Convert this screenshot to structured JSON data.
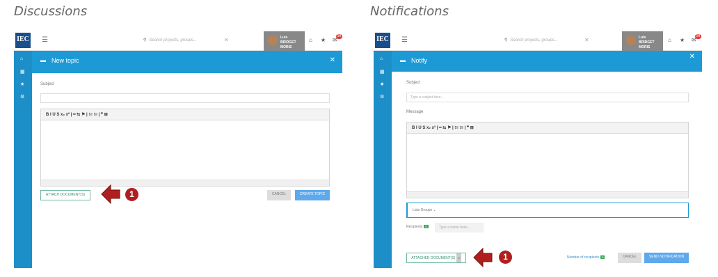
{
  "captions": {
    "left": "Discussions",
    "right": "Notifications"
  },
  "app": {
    "logo": "IEC",
    "search_placeholder": "Search projects, groups...",
    "user_line1": "Luis",
    "user_line2": "BRIDGET MORIS",
    "notification_count": "99"
  },
  "discussions": {
    "header_title": "New topic",
    "subject_label": "Subject",
    "attach_button": "ATTACH DOCUMENT(S)",
    "cancel_button": "CANCEL",
    "create_button": "CREATE TOPIC",
    "callout": "1"
  },
  "notifications": {
    "header_title": "Notify",
    "subject_label": "Subject",
    "subject_placeholder": "Type a subject here...",
    "message_label": "Message",
    "lists_groups": "Lists Groups",
    "recipients_label": "Recipients",
    "recipients_count": "0",
    "recipients_placeholder": "Type a name here...",
    "attached_button": "ATTACHED DOCUMENT(S)",
    "attached_count": "0",
    "number_of_recipients": "Number of recipients",
    "number_of_recipients_count": "0",
    "cancel_button": "CANCEL",
    "send_button": "SEND NOTIFICATION",
    "callout": "1"
  },
  "toolbar": "B  I  U  S  x₂  x²  |  ━  ⇆  ⚑  |  ⁝≡  ⁝≡  |  ❞  ⊞",
  "colors": {
    "sidebar": "#1d8fc8",
    "header": "#1d9ad6",
    "primary_button": "#5ea9ec",
    "callout_red": "#b01f1f"
  }
}
